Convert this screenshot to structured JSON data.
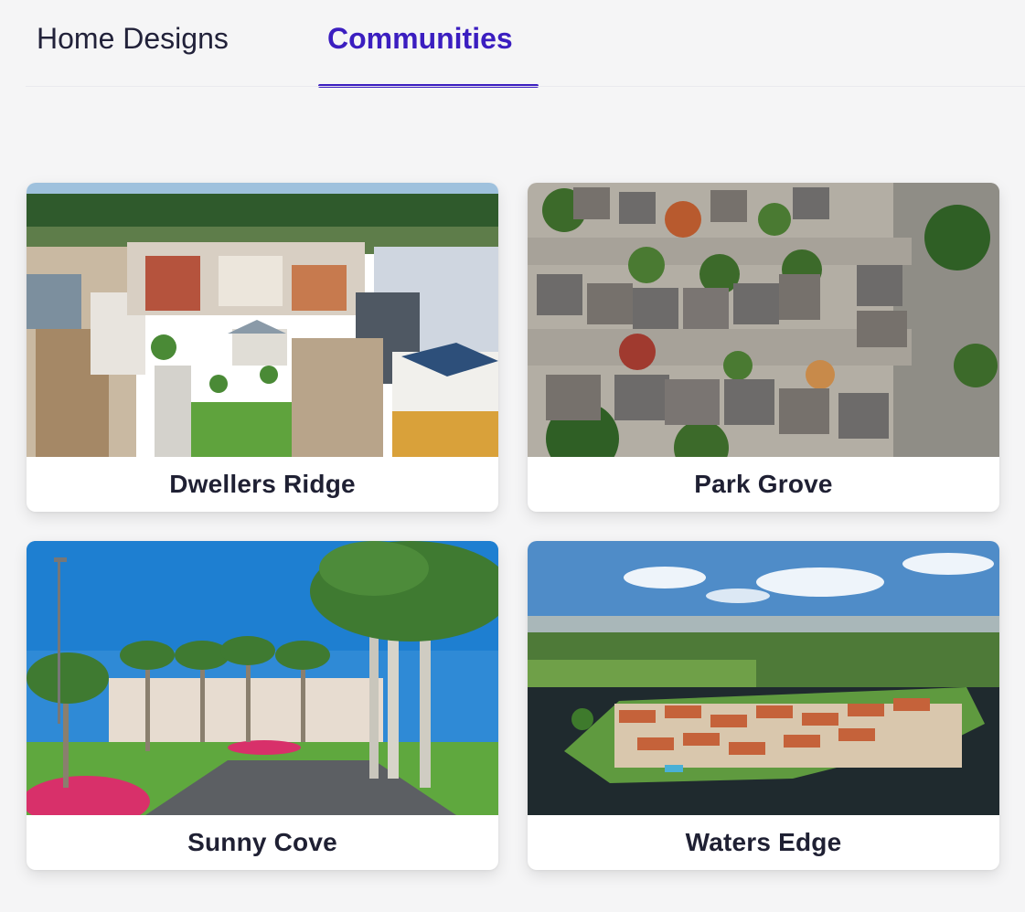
{
  "tabs": [
    {
      "label": "Home Designs",
      "active": false
    },
    {
      "label": "Communities",
      "active": true
    }
  ],
  "accent_color": "#3b1ec0",
  "communities": [
    {
      "name": "Dwellers Ridge",
      "image": "aerial view of modern townhouse community with courtyard garden"
    },
    {
      "name": "Park Grove",
      "image": "top-down aerial view of suburban houses and trees"
    },
    {
      "name": "Sunny Cove",
      "image": "palm-lined road with flower beds under blue sky"
    },
    {
      "name": "Waters Edge",
      "image": "aerial view of waterfront homes surrounded by lake and golf course"
    }
  ]
}
